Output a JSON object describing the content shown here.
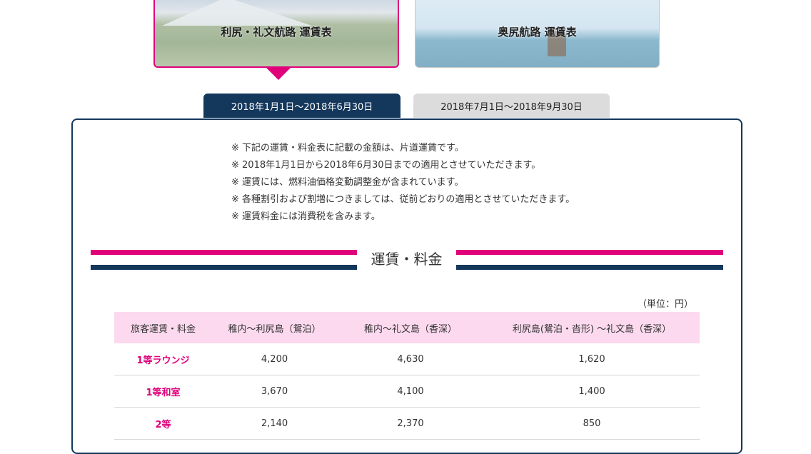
{
  "routes": {
    "rishiri_rebun": "利尻・礼文航路 運賃表",
    "okushiri": "奥尻航路 運賃表"
  },
  "tabs": {
    "period1": "2018年1月1日～2018年6月30日",
    "period2": "2018年7月1日～2018年9月30日"
  },
  "notes": [
    "※ 下記の運賃・料金表に記載の金額は、片道運賃です。",
    "※ 2018年1月1日から2018年6月30日までの適用とさせていただきます。",
    "※ 運賃には、燃料油価格変動調整金が含まれています。",
    "※ 各種割引および割増につきましては、従前どおりの適用とさせていただきます。",
    "※ 運賃料金には消費税を含みます。"
  ],
  "section_title": "運賃・料金",
  "unit": "（単位：円）",
  "table": {
    "headers": [
      "旅客運賃・料金",
      "稚内～利尻島（鴛泊）",
      "稚内～礼文島（香深）",
      "利尻島(鴛泊・沓形) ～礼文島（香深）"
    ],
    "rows": [
      [
        "1等ラウンジ",
        "4,200",
        "4,630",
        "1,620"
      ],
      [
        "1等和室",
        "3,670",
        "4,100",
        "1,400"
      ],
      [
        "2等",
        "2,140",
        "2,370",
        "850"
      ]
    ]
  },
  "colors": {
    "accent_pink": "#e0007a",
    "navy": "#14375c",
    "header_pink": "#fcd9ef"
  }
}
